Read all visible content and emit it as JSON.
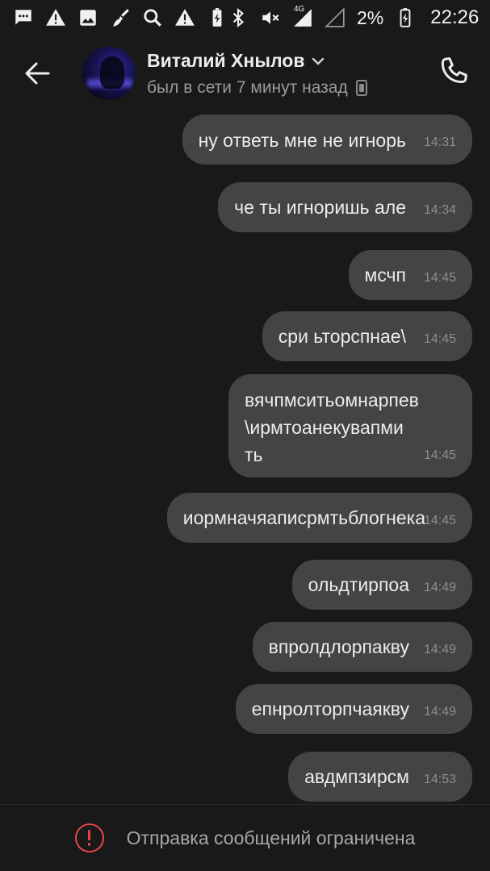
{
  "status_bar": {
    "battery": "2%",
    "time": "22:26",
    "network": "4G",
    "left_icons": [
      "messages-icon",
      "warning-icon",
      "image-icon",
      "broom-icon",
      "search-icon",
      "warning-icon",
      "battery-saver-icon"
    ],
    "right_icons": [
      "bluetooth-icon",
      "mute-icon",
      "signal-icon",
      "signal-empty-icon",
      "battery-icon"
    ]
  },
  "header": {
    "contact_name": "Виталий Хнылов",
    "status": "был в сети 7 минут назад"
  },
  "messages": [
    {
      "text": "ну ответь мне не игнорь",
      "time": "14:31"
    },
    {
      "text": "че ты игноришь але",
      "time": "14:34"
    },
    {
      "text": "мсчп",
      "time": "14:45"
    },
    {
      "text": "сри ьторспнае\\",
      "time": "14:45"
    },
    {
      "lines": [
        "вячпмситьомнарпев",
        "\\ирмтоанекувапми",
        "ть"
      ],
      "time": "14:45"
    },
    {
      "text": "иормначяаписрмтьблогнека",
      "time": "14:45"
    },
    {
      "text": "ольдтирпоа",
      "time": "14:49"
    },
    {
      "text": "впролдлорпакву",
      "time": "14:49"
    },
    {
      "text": "епнролторпчаякву",
      "time": "14:49"
    },
    {
      "text": "авдмпзирсм",
      "time": "14:53"
    }
  ],
  "bottom": {
    "restriction_text": "Отправка сообщений ограничена"
  },
  "colors": {
    "background": "#19191a",
    "bubble": "#444446",
    "warning": "#e64646"
  }
}
